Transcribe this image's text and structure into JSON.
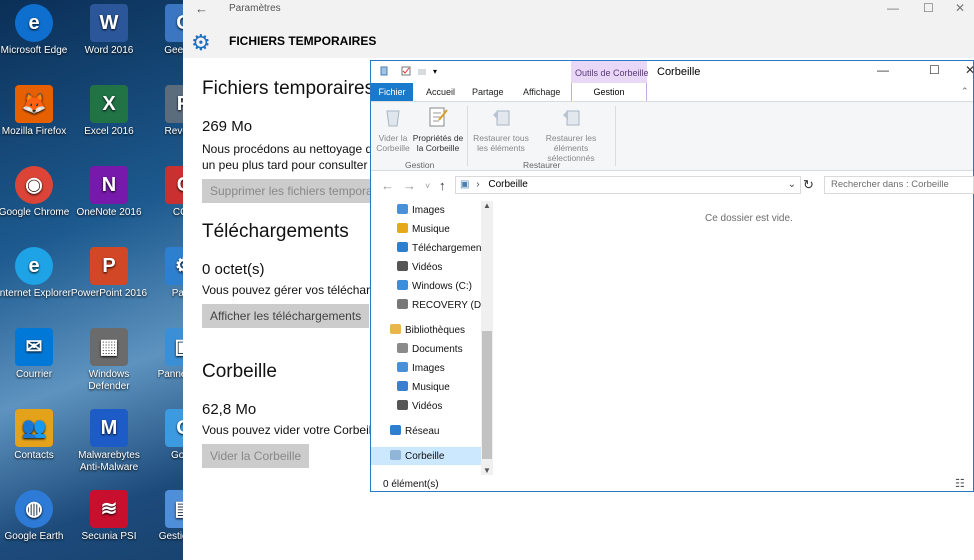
{
  "desktop": {
    "icons": [
      {
        "label": "Microsoft Edge",
        "color": "#0f6fcf",
        "glyph": "e"
      },
      {
        "label": "Word 2016",
        "color": "#2b579a",
        "glyph": "W"
      },
      {
        "label": "Geek Un",
        "color": "#3a76c2",
        "glyph": "G"
      },
      {
        "label": "Mozilla Firefox",
        "color": "#e66000",
        "glyph": "🦊"
      },
      {
        "label": "Excel 2016",
        "color": "#217346",
        "glyph": "X"
      },
      {
        "label": "Revo Un",
        "color": "#5b6c7d",
        "glyph": "R"
      },
      {
        "label": "Google Chrome",
        "color": "#db4437",
        "glyph": "◉"
      },
      {
        "label": "OneNote 2016",
        "color": "#7719aa",
        "glyph": "N"
      },
      {
        "label": "CCle",
        "color": "#c8312f",
        "glyph": "C"
      },
      {
        "label": "Internet Explorer",
        "color": "#1ea3e6",
        "glyph": "e"
      },
      {
        "label": "PowerPoint 2016",
        "color": "#d24726",
        "glyph": "P"
      },
      {
        "label": "Parar",
        "color": "#2d7fd0",
        "glyph": "⚙"
      },
      {
        "label": "Courrier",
        "color": "#0078d7",
        "glyph": "✉"
      },
      {
        "label": "Windows Defender",
        "color": "#6b6b6b",
        "glyph": "▦"
      },
      {
        "label": "Panne confi",
        "color": "#3b8fd6",
        "glyph": "▣"
      },
      {
        "label": "Contacts",
        "color": "#e3a21a",
        "glyph": "👥"
      },
      {
        "label": "Malwarebytes Anti-Malware",
        "color": "#1d5cc7",
        "glyph": "M"
      },
      {
        "label": "GodN",
        "color": "#3c9be0",
        "glyph": "G"
      },
      {
        "label": "Google Earth",
        "color": "#2d7bd6",
        "glyph": "◍"
      },
      {
        "label": "Secunia PSI",
        "color": "#c8102e",
        "glyph": "≋"
      },
      {
        "label": "Gestion tâc",
        "color": "#4f8ed9",
        "glyph": "▤"
      }
    ]
  },
  "settings": {
    "app_title": "Paramètres",
    "page_title": "FICHIERS TEMPORAIRES",
    "sections": [
      {
        "title": "Fichiers temporaires",
        "size": "269 Mo",
        "text": [
          "Nous procédons au nettoyage d",
          "un peu plus tard pour consulter"
        ],
        "button": "Supprimer les fichiers tempora",
        "button_enabled": false
      },
      {
        "title": "Téléchargements",
        "size": "0 octet(s)",
        "text": [
          "Vous pouvez gérer vos télécharg"
        ],
        "button": "Afficher les téléchargements",
        "button_enabled": true
      },
      {
        "title": "Corbeille",
        "size": "62,8 Mo",
        "text": [
          "Vous pouvez vider votre Corbeill"
        ],
        "button": "Vider la Corbeille",
        "button_enabled": false
      }
    ]
  },
  "explorer": {
    "context_tab": "Outils de Corbeille",
    "window_title": "Corbeille",
    "tabs": {
      "fichier": "Fichier",
      "accueil": "Accueil",
      "partage": "Partage",
      "affichage": "Affichage",
      "gestion": "Gestion"
    },
    "ribbon": {
      "empty_bin": [
        "Vider la",
        "Corbeille"
      ],
      "properties": [
        "Propriétés de",
        "la Corbeille"
      ],
      "group_gestion": "Gestion",
      "restore_all": [
        "Restaurer tous",
        "les éléments"
      ],
      "restore_selected": [
        "Restaurer les",
        "éléments sélectionnés"
      ],
      "group_restaurer": "Restaurer"
    },
    "address": "Corbeille",
    "search_placeholder": "Rechercher dans : Corbeille",
    "nav": [
      {
        "label": "Images",
        "indent": 1,
        "icon": "images-icon",
        "color": "#4a90d9"
      },
      {
        "label": "Musique",
        "indent": 1,
        "icon": "music-icon",
        "color": "#e6a817"
      },
      {
        "label": "Téléchargements",
        "indent": 1,
        "icon": "download-icon",
        "color": "#2f7fd1"
      },
      {
        "label": "Vidéos",
        "indent": 1,
        "icon": "videos-icon",
        "color": "#555555"
      },
      {
        "label": "Windows (C:)",
        "indent": 1,
        "icon": "drive-icon",
        "color": "#3a8fdc"
      },
      {
        "label": "RECOVERY (D:)",
        "indent": 1,
        "icon": "drive-icon",
        "color": "#777777"
      },
      {
        "label": "Bibliothèques",
        "indent": 0,
        "icon": "library-icon",
        "color": "#e8b64a"
      },
      {
        "label": "Documents",
        "indent": 1,
        "icon": "documents-icon",
        "color": "#8a8a8a"
      },
      {
        "label": "Images",
        "indent": 1,
        "icon": "images-icon",
        "color": "#4a90d9"
      },
      {
        "label": "Musique",
        "indent": 1,
        "icon": "music-icon",
        "color": "#3a7fd0"
      },
      {
        "label": "Vidéos",
        "indent": 1,
        "icon": "videos-icon",
        "color": "#555555"
      },
      {
        "label": "Réseau",
        "indent": 0,
        "icon": "network-icon",
        "color": "#2f7fd1"
      },
      {
        "label": "Corbeille",
        "indent": 0,
        "icon": "recycle-bin-icon",
        "color": "#8fb5d8",
        "selected": true
      }
    ],
    "empty_message": "Ce dossier est vide.",
    "status": "0 élément(s)"
  }
}
